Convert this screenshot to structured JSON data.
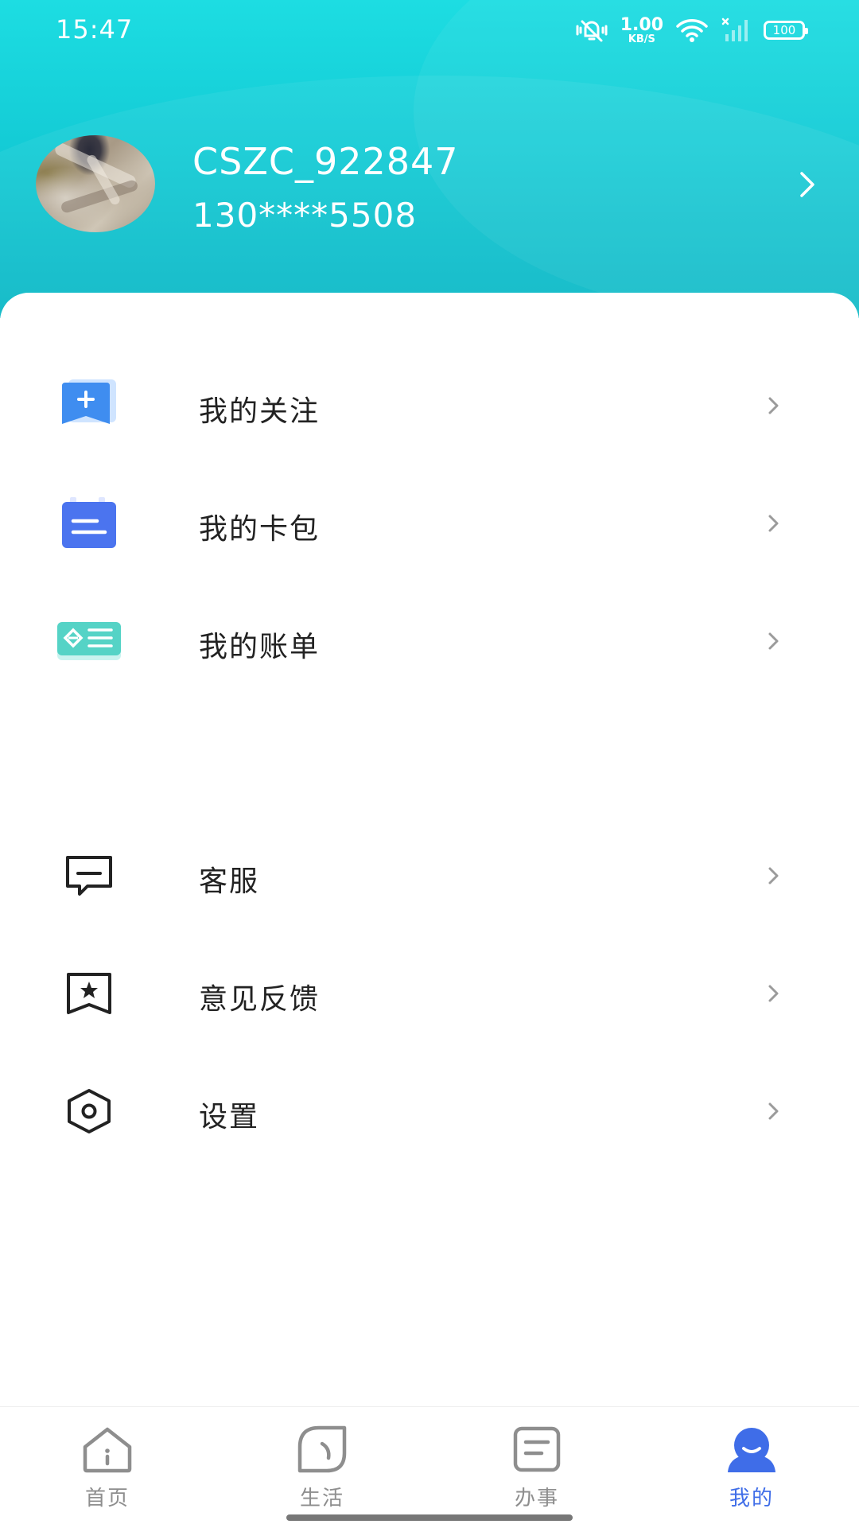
{
  "status_bar": {
    "time": "15:47",
    "net_speed_value": "1.00",
    "net_speed_unit": "KB/S",
    "battery": "100",
    "icons": [
      "mute-vibrate-icon",
      "wifi-icon",
      "signal-icon",
      "battery-icon"
    ]
  },
  "profile": {
    "username": "CSZC_922847",
    "phone": "130****5508"
  },
  "menu": {
    "group1": [
      {
        "label": "我的关注",
        "icon": "bookmark-plus-icon"
      },
      {
        "label": "我的卡包",
        "icon": "card-wallet-icon"
      },
      {
        "label": "我的账单",
        "icon": "bill-icon"
      }
    ],
    "group2": [
      {
        "label": "客服",
        "icon": "chat-message-icon"
      },
      {
        "label": "意见反馈",
        "icon": "feedback-star-icon"
      },
      {
        "label": "设置",
        "icon": "settings-hexagon-icon"
      }
    ]
  },
  "bottom_nav": {
    "items": [
      {
        "label": "首页",
        "icon": "home-icon",
        "active": false
      },
      {
        "label": "生活",
        "icon": "life-leaf-icon",
        "active": false
      },
      {
        "label": "办事",
        "icon": "tasks-icon",
        "active": false
      },
      {
        "label": "我的",
        "icon": "profile-icon",
        "active": true
      }
    ]
  },
  "colors": {
    "header_gradient_top": "#1ddde2",
    "header_gradient_bottom": "#0ab7c5",
    "active_nav": "#3f6de8",
    "inactive_nav": "#8e8e8e"
  }
}
